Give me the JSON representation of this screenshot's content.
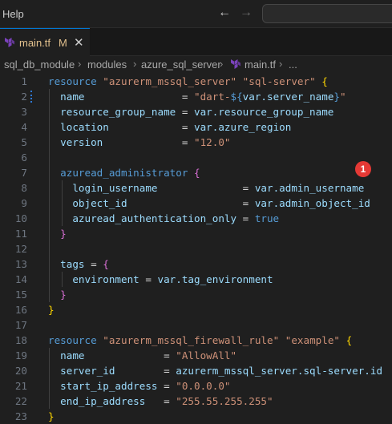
{
  "menu": {
    "help": "Help"
  },
  "titlebar": {
    "back_icon": "arrow-left-icon",
    "forward_icon": "arrow-right-icon"
  },
  "tab": {
    "filename": "main.tf",
    "badge": "M",
    "close": "✕",
    "icon": "terraform-icon"
  },
  "breadcrumb": [
    "sql_db_module",
    "modules",
    "azure_sql_server",
    "main.tf",
    "..."
  ],
  "callout": "1",
  "colors": {
    "accent": "#0078d4",
    "modified": "#e2c08d",
    "badge": "#e53935"
  },
  "lines": [
    {
      "n": "1",
      "tokens": [
        [
          "kw",
          "resource"
        ],
        [
          "plain",
          " "
        ],
        [
          "str",
          "\"azurerm_mssql_server\""
        ],
        [
          "plain",
          " "
        ],
        [
          "str",
          "\"sql-server\""
        ],
        [
          "plain",
          " "
        ],
        [
          "bracket",
          "{"
        ]
      ]
    },
    {
      "n": "2",
      "tokens": [
        [
          "plain",
          "  "
        ],
        [
          "pr",
          "name"
        ],
        [
          "plain",
          "                = "
        ],
        [
          "str",
          "\"dart-"
        ],
        [
          "interp",
          "${"
        ],
        [
          "pr",
          "var.server_name"
        ],
        [
          "interp",
          "}"
        ],
        [
          "str",
          "\""
        ]
      ]
    },
    {
      "n": "3",
      "tokens": [
        [
          "plain",
          "  "
        ],
        [
          "pr",
          "resource_group_name"
        ],
        [
          "plain",
          " = "
        ],
        [
          "pr",
          "var.resource_group_name"
        ]
      ]
    },
    {
      "n": "4",
      "tokens": [
        [
          "plain",
          "  "
        ],
        [
          "pr",
          "location"
        ],
        [
          "plain",
          "            = "
        ],
        [
          "pr",
          "var.azure_region"
        ]
      ]
    },
    {
      "n": "5",
      "tokens": [
        [
          "plain",
          "  "
        ],
        [
          "pr",
          "version"
        ],
        [
          "plain",
          "             = "
        ],
        [
          "str",
          "\"12.0\""
        ]
      ]
    },
    {
      "n": "6",
      "tokens": []
    },
    {
      "n": "7",
      "tokens": [
        [
          "plain",
          "  "
        ],
        [
          "kw",
          "azuread_administrator"
        ],
        [
          "plain",
          " "
        ],
        [
          "brk2",
          "{"
        ]
      ]
    },
    {
      "n": "8",
      "tokens": [
        [
          "plain",
          "    "
        ],
        [
          "pr",
          "login_username"
        ],
        [
          "plain",
          "              = "
        ],
        [
          "pr",
          "var.admin_username"
        ]
      ]
    },
    {
      "n": "9",
      "tokens": [
        [
          "plain",
          "    "
        ],
        [
          "pr",
          "object_id"
        ],
        [
          "plain",
          "                   = "
        ],
        [
          "pr",
          "var.admin_object_id"
        ]
      ]
    },
    {
      "n": "10",
      "tokens": [
        [
          "plain",
          "    "
        ],
        [
          "pr",
          "azuread_authentication_only"
        ],
        [
          "plain",
          " = "
        ],
        [
          "kw",
          "true"
        ]
      ]
    },
    {
      "n": "11",
      "tokens": [
        [
          "plain",
          "  "
        ],
        [
          "brk2",
          "}"
        ]
      ]
    },
    {
      "n": "12",
      "tokens": []
    },
    {
      "n": "13",
      "tokens": [
        [
          "plain",
          "  "
        ],
        [
          "pr",
          "tags"
        ],
        [
          "plain",
          " = "
        ],
        [
          "brk2",
          "{"
        ]
      ]
    },
    {
      "n": "14",
      "tokens": [
        [
          "plain",
          "    "
        ],
        [
          "pr",
          "environment"
        ],
        [
          "plain",
          " = "
        ],
        [
          "pr",
          "var.tag_environment"
        ]
      ]
    },
    {
      "n": "15",
      "tokens": [
        [
          "plain",
          "  "
        ],
        [
          "brk2",
          "}"
        ]
      ]
    },
    {
      "n": "16",
      "tokens": [
        [
          "bracket",
          "}"
        ]
      ]
    },
    {
      "n": "17",
      "tokens": []
    },
    {
      "n": "18",
      "tokens": [
        [
          "kw",
          "resource"
        ],
        [
          "plain",
          " "
        ],
        [
          "str",
          "\"azurerm_mssql_firewall_rule\""
        ],
        [
          "plain",
          " "
        ],
        [
          "str",
          "\"example\""
        ],
        [
          "plain",
          " "
        ],
        [
          "bracket",
          "{"
        ]
      ]
    },
    {
      "n": "19",
      "tokens": [
        [
          "plain",
          "  "
        ],
        [
          "pr",
          "name"
        ],
        [
          "plain",
          "             = "
        ],
        [
          "str",
          "\"AllowAll\""
        ]
      ]
    },
    {
      "n": "20",
      "tokens": [
        [
          "plain",
          "  "
        ],
        [
          "pr",
          "server_id"
        ],
        [
          "plain",
          "        = "
        ],
        [
          "pr",
          "azurerm_mssql_server.sql-server.id"
        ]
      ]
    },
    {
      "n": "21",
      "tokens": [
        [
          "plain",
          "  "
        ],
        [
          "pr",
          "start_ip_address"
        ],
        [
          "plain",
          " = "
        ],
        [
          "str",
          "\"0.0.0.0\""
        ]
      ]
    },
    {
      "n": "22",
      "tokens": [
        [
          "plain",
          "  "
        ],
        [
          "pr",
          "end_ip_address"
        ],
        [
          "plain",
          "   = "
        ],
        [
          "str",
          "\"255.55.255.255\""
        ]
      ]
    },
    {
      "n": "23",
      "tokens": [
        [
          "bracket",
          "}"
        ]
      ]
    }
  ]
}
